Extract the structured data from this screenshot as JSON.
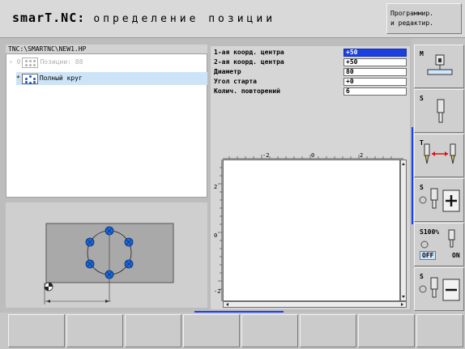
{
  "header": {
    "title_brand": "smarT.NC:",
    "title_text": "определение позиции",
    "mode_line1": "Программир.",
    "mode_line2": "и редактир."
  },
  "tree": {
    "path": "TNC:\\SMARTNC\\NEW1.HP",
    "item1": "Позиции: 88",
    "item1_prefix": "▿ 0",
    "item2": "Полный круг",
    "item2_prefix": "*"
  },
  "form": {
    "fields": [
      {
        "label": "1-ая коорд. центра",
        "value": "+50"
      },
      {
        "label": "2-ая коорд. центра",
        "value": "+50"
      },
      {
        "label": "Диаметр",
        "value": "80"
      },
      {
        "label": "Угол старта",
        "value": "+0"
      },
      {
        "label": "Колич. повторений",
        "value": "6"
      }
    ]
  },
  "plan": {
    "hruler_labels": [
      "-2",
      "0",
      "2"
    ],
    "vruler_labels": [
      "2",
      "0",
      "-2"
    ]
  },
  "softkeys": {
    "m_label": "M",
    "s_label": "S",
    "t_label": "T",
    "s_plus_label": "S",
    "override_label": "S100%",
    "off_label": "OFF",
    "on_label": "ON",
    "s_minus_label": "S"
  },
  "colors": {
    "accent": "#1a3cff",
    "field_active": "#1c3fe0",
    "hole_fill": "#1a6ad8"
  },
  "icons": [
    "machine-icon",
    "spindle-icon",
    "tool-length-icon",
    "plus-icon",
    "minus-icon",
    "circle-pattern-icon"
  ]
}
